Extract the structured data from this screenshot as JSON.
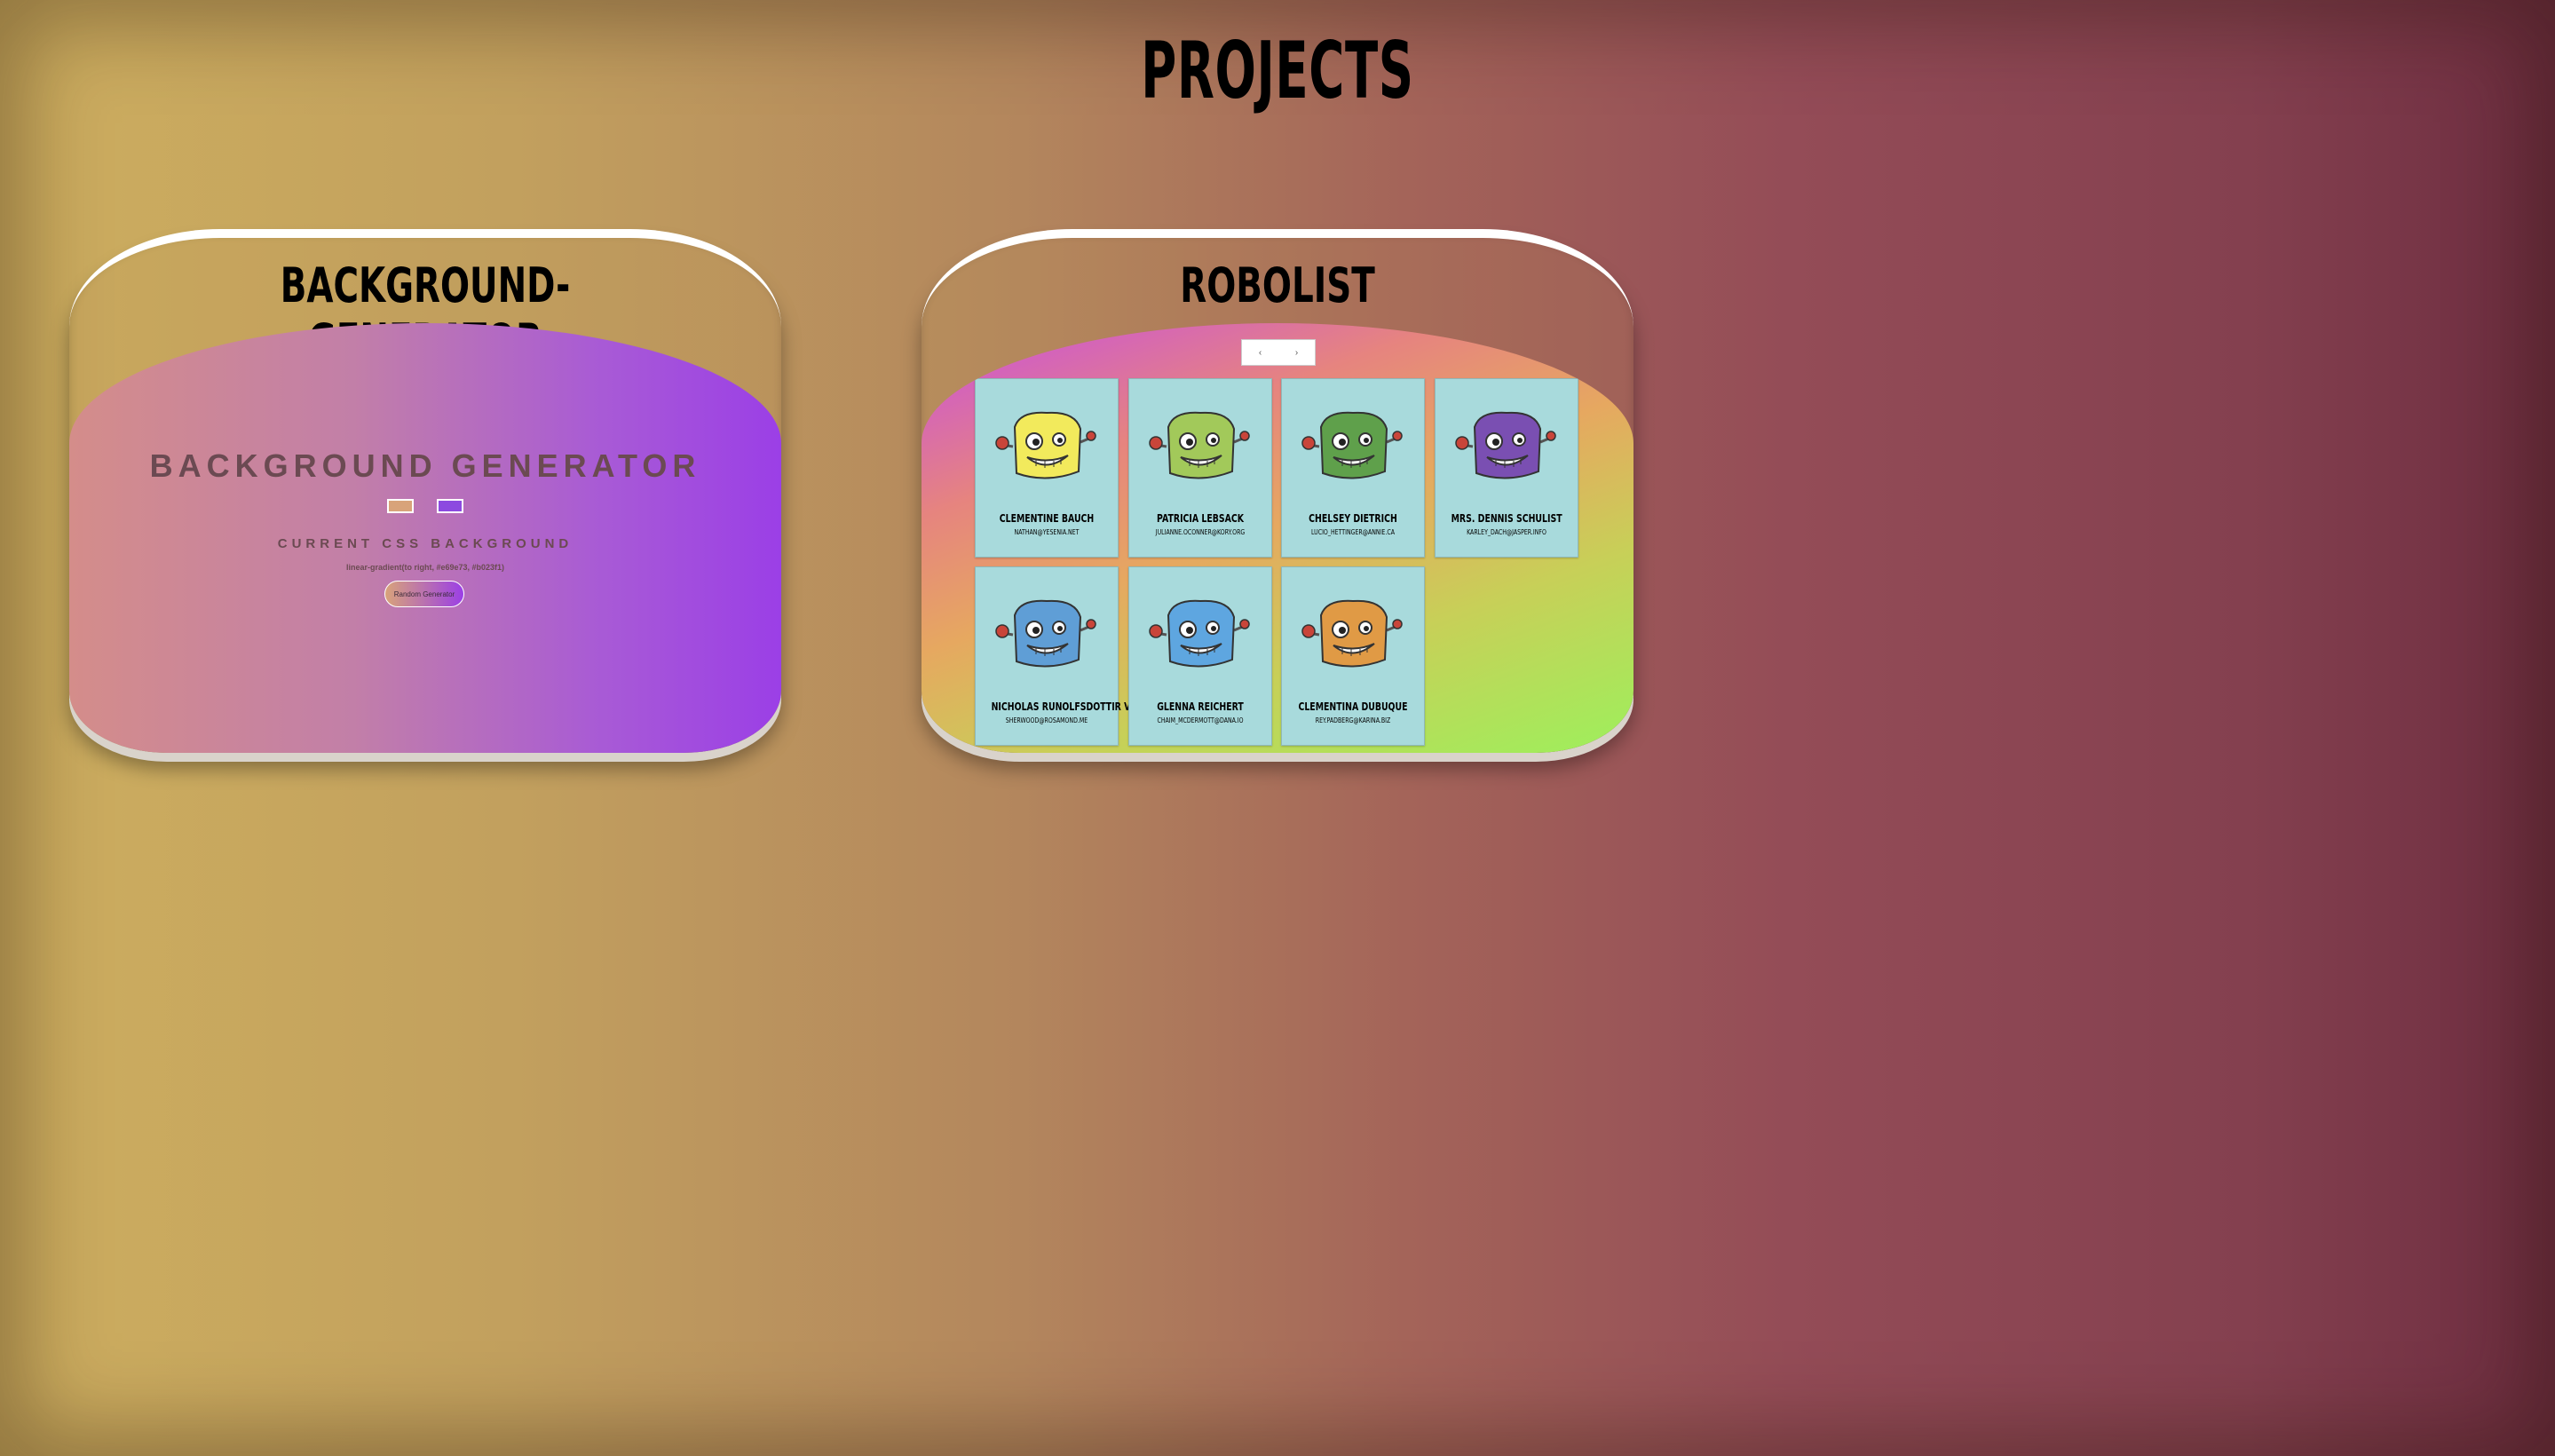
{
  "page": {
    "title": "PROJECTS"
  },
  "projects": [
    {
      "title": "BACKGROUND-GENERATOR",
      "preview": {
        "heading": "BACKGROUND GENERATOR",
        "swatch_colors": [
          "#d8a37a",
          "#8c4ae0"
        ],
        "subheading": "CURRENT CSS BACKGROUND",
        "css_value": "linear-gradient(to right, #e69e73, #b023f1)",
        "button_label": "Random Generator"
      }
    },
    {
      "title": "ROBOLIST",
      "search": {
        "prev_label": "‹",
        "next_label": "›"
      },
      "robots": [
        {
          "name": "CLEMENTINE BAUCH",
          "email": "NATHAN@YESENIA.NET",
          "color": "#f2ea5c"
        },
        {
          "name": "PATRICIA LEBSACK",
          "email": "JULIANNE.OCONNER@KORY.ORG",
          "color": "#a2c95a"
        },
        {
          "name": "CHELSEY DIETRICH",
          "email": "LUCIO_HETTINGER@ANNIE.CA",
          "color": "#5fa04b"
        },
        {
          "name": "MRS. DENNIS SCHULIST",
          "email": "KARLEY_DACH@JASPER.INFO",
          "color": "#7a4fb2"
        },
        {
          "name": "NICHOLAS RUNOLFSDOTTIR V",
          "email": "SHERWOOD@ROSAMOND.ME",
          "color": "#5f9ed6"
        },
        {
          "name": "GLENNA REICHERT",
          "email": "CHAIM_MCDERMOTT@DANA.IO",
          "color": "#5ea6e0"
        },
        {
          "name": "CLEMENTINA DUBUQUE",
          "email": "REY.PADBERG@KARINA.BIZ",
          "color": "#e09a45"
        }
      ]
    }
  ]
}
